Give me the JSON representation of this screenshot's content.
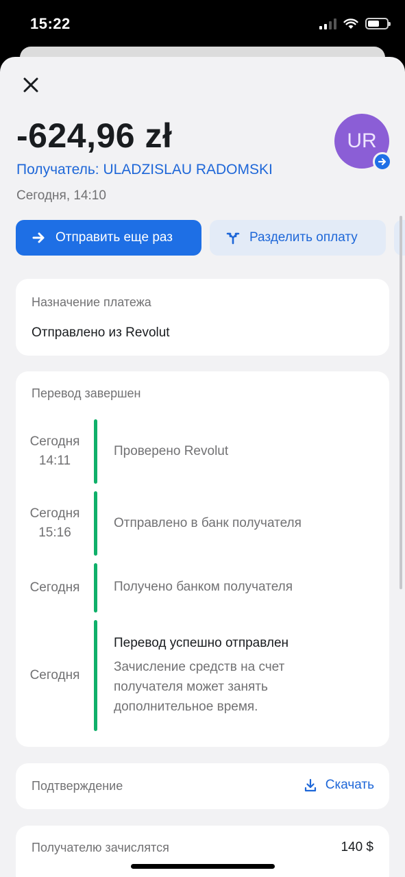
{
  "status_bar": {
    "time": "15:22"
  },
  "transaction": {
    "amount": "-624,96 zł",
    "recipient_line": "Получатель: ULADZISLAU RADOMSKI",
    "date": "Сегодня, 14:10",
    "avatar_initials": "UR"
  },
  "actions": {
    "send_again": "Отправить еще раз",
    "split_payment": "Разделить оплату"
  },
  "purpose": {
    "label": "Назначение платежа",
    "value": "Отправлено из Revolut"
  },
  "timeline": {
    "title": "Перевод завершен",
    "steps": [
      {
        "day": "Сегодня",
        "time": "14:11",
        "text": "Проверено Revolut"
      },
      {
        "day": "Сегодня",
        "time": "15:16",
        "text": "Отправлено в банк получателя"
      },
      {
        "day": "Сегодня",
        "time": "",
        "text": "Получено банком получателя"
      },
      {
        "day": "Сегодня",
        "time": "",
        "title": "Перевод успешно отправлен",
        "text": "Зачисление средств на счет получателя может занять дополнительное время."
      }
    ]
  },
  "confirmation": {
    "label": "Подтверждение",
    "download": "Скачать"
  },
  "credit": {
    "label": "Получателю зачислятся",
    "value": "140 $"
  },
  "colors": {
    "accent": "#1e6fe5",
    "link": "#1e67d8",
    "avatar": "#8b5ed6",
    "timeline": "#10b06a"
  },
  "icons": [
    "close-icon",
    "arrow-right-icon",
    "split-icon",
    "download-icon",
    "chevron-right-badge-icon"
  ]
}
